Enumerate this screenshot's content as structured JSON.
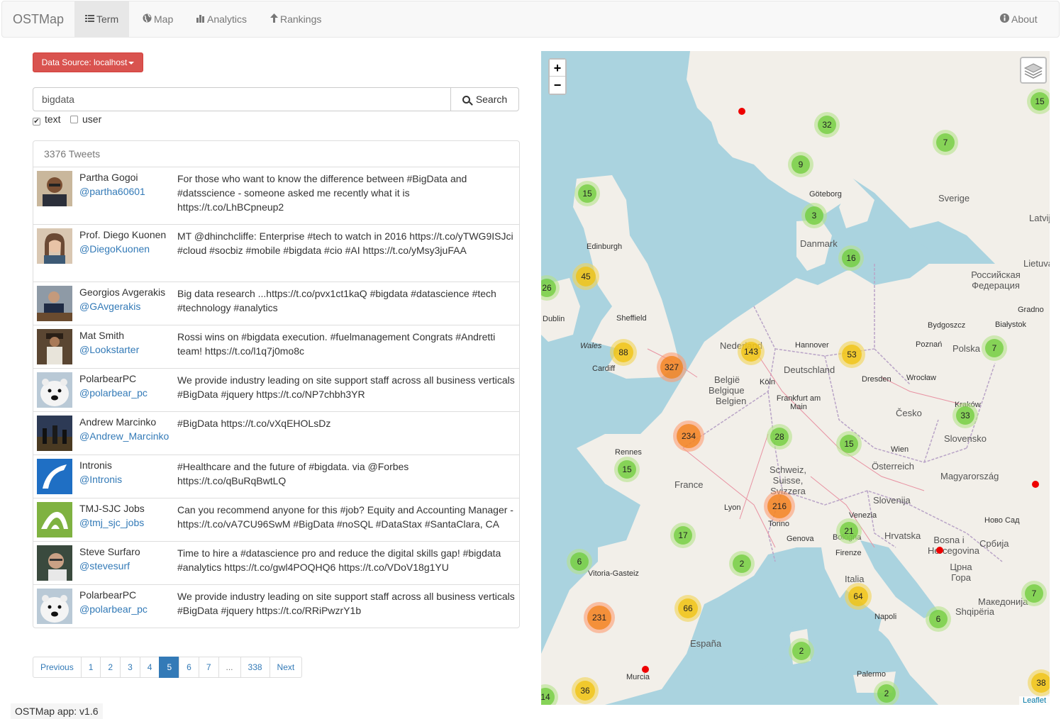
{
  "navbar": {
    "brand": "OSTMap",
    "items": [
      {
        "label": "Term",
        "icon": "list-icon",
        "active": true
      },
      {
        "label": "Map",
        "icon": "globe-icon"
      },
      {
        "label": "Analytics",
        "icon": "bar-chart-icon"
      },
      {
        "label": "Rankings",
        "icon": "arrow-up-icon"
      }
    ],
    "about": "About"
  },
  "datasource": {
    "label": "Data Source: localhost"
  },
  "search": {
    "value": "bigdata",
    "button": "Search"
  },
  "filters": [
    {
      "label": "text",
      "checked": true
    },
    {
      "label": "user",
      "checked": false
    }
  ],
  "tweets": {
    "count_label": "3376 Tweets",
    "items": [
      {
        "name": "Partha Gogoi",
        "handle": "@partha60601",
        "text": "For those who want to know the difference between #BigData and #datsscience - someone asked me recently what it is https://t.co/LhBCpneup2"
      },
      {
        "name": "Prof. Diego Kuonen",
        "handle": "@DiegoKuonen",
        "text": "MT @dhinchcliffe: Enterprise #tech to watch in 2016 https://t.co/yTWG9ISJci #cloud #socbiz #mobile #bigdata #cio #AI https://t.co/yMsy3juFAA"
      },
      {
        "name": "Georgios Avgerakis",
        "handle": "@GAvgerakis",
        "text": "Big data research ...https://t.co/pvx1ct1kaQ #bigdata #datascience #tech #technology #analytics"
      },
      {
        "name": "Mat Smith",
        "handle": "@Lookstarter",
        "text": "Rossi wins on #bigdata execution. #fuelmanagement Congrats #Andretti team! https://t.co/l1q7j0mo8c"
      },
      {
        "name": "PolarbearPC",
        "handle": "@polarbear_pc",
        "text": "We provide industry leading on site support staff across all business verticals #BigData #jquery https://t.co/NP7chbh3YR"
      },
      {
        "name": "Andrew Marcinko",
        "handle": "@Andrew_Marcinko",
        "text": "#BigData https://t.co/vXqEHOLsDz"
      },
      {
        "name": "Intronis",
        "handle": "@Intronis",
        "text": "#Healthcare and the future of #bigdata. via @Forbes https://t.co/qBuRqBwtLQ"
      },
      {
        "name": "TMJ-SJC Jobs",
        "handle": "@tmj_sjc_jobs",
        "text": "Can you recommend anyone for this #job? Equity and Accounting Manager - https://t.co/vA7CU96SwM #BigData #noSQL #DataStax #SantaClara, CA"
      },
      {
        "name": "Steve Surfaro",
        "handle": "@stevesurf",
        "text": "Time to hire a #datascience pro and reduce the digital skills gap! #bigdata #analytics https://t.co/gwl4POQHQ6 https://t.co/VDoV18g1YU"
      },
      {
        "name": "PolarbearPC",
        "handle": "@polarbear_pc",
        "text": "We provide industry leading on site support staff across all business verticals #BigData #jquery https://t.co/RRiPwzrY1b"
      }
    ]
  },
  "pagination": {
    "previous": "Previous",
    "pages": [
      "1",
      "2",
      "3",
      "4",
      "5",
      "6",
      "7",
      "...",
      "338"
    ],
    "active": "5",
    "next": "Next"
  },
  "footer": "OSTMap app: v1.6",
  "map": {
    "zoom_in": "+",
    "zoom_out": "−",
    "attribution": "Leaflet",
    "places": [
      {
        "name": "Edinburgh"
      },
      {
        "name": "Dublin"
      },
      {
        "name": "Sheffield"
      },
      {
        "name": "Cardiff"
      },
      {
        "name": "Wales"
      },
      {
        "name": "Nederland"
      },
      {
        "name": "België"
      },
      {
        "name": "Belgique"
      },
      {
        "name": "Belgien"
      },
      {
        "name": "Köln"
      },
      {
        "name": "Hannover"
      },
      {
        "name": "Deutschland"
      },
      {
        "name": "Dresden"
      },
      {
        "name": "Frankfurt am Main"
      },
      {
        "name": "Rennes"
      },
      {
        "name": "France"
      },
      {
        "name": "Lyon"
      },
      {
        "name": "Torino"
      },
      {
        "name": "Genova"
      },
      {
        "name": "Bologna"
      },
      {
        "name": "Firenze"
      },
      {
        "name": "Italia"
      },
      {
        "name": "Napoli"
      },
      {
        "name": "Palermo"
      },
      {
        "name": "España"
      },
      {
        "name": "Murcia"
      },
      {
        "name": "Vitoria-Gasteiz"
      },
      {
        "name": "Danmark"
      },
      {
        "name": "Göteborg"
      },
      {
        "name": "Sverige"
      },
      {
        "name": "Polska"
      },
      {
        "name": "Poznań"
      },
      {
        "name": "Wrocław"
      },
      {
        "name": "Bydgoszcz"
      },
      {
        "name": "Białystok"
      },
      {
        "name": "Kraków"
      },
      {
        "name": "Česko"
      },
      {
        "name": "Slovensko"
      },
      {
        "name": "Wien"
      },
      {
        "name": "Österreich"
      },
      {
        "name": "Magyarország"
      },
      {
        "name": "Slovenija"
      },
      {
        "name": "Hrvatska"
      },
      {
        "name": "Bosna i Hercegovina"
      },
      {
        "name": "Србија"
      },
      {
        "name": "Црна Гора"
      },
      {
        "name": "Shqipëria"
      },
      {
        "name": "Македонија"
      },
      {
        "name": "Schweiz, Suisse, Svizzera"
      },
      {
        "name": "Venezia"
      },
      {
        "name": "Российская Федерация"
      },
      {
        "name": "Lietuva"
      },
      {
        "name": "Latvija"
      },
      {
        "name": "Ново Сад"
      },
      {
        "name": "Gradno"
      }
    ],
    "clusters": [
      "15",
      "32",
      "7",
      "9",
      "15",
      "3",
      "16",
      "45",
      "26",
      "88",
      "327",
      "143",
      "53",
      "7",
      "234",
      "28",
      "15",
      "33",
      "15",
      "216",
      "17",
      "21",
      "6",
      "2",
      "66",
      "231",
      "64",
      "6",
      "7",
      "2",
      "36",
      "2",
      "38",
      "14"
    ]
  }
}
